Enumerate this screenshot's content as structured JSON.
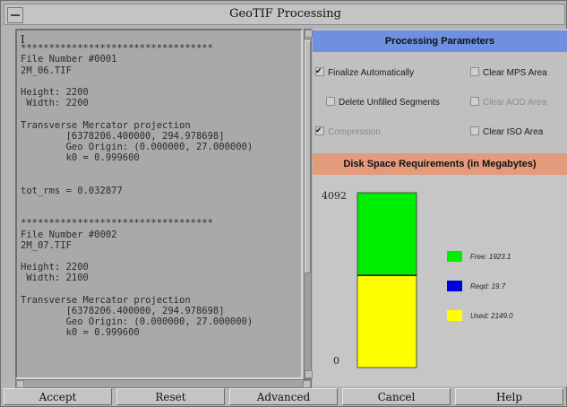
{
  "window": {
    "title": "GeoTIF Processing"
  },
  "log": {
    "caret": "I",
    "text": "\n**********************************\nFile Number #0001\n2M_06.TIF\n\nHeight: 2200\n Width: 2200\n\nTransverse Mercator projection\n        [6378206.400000, 294.978698]\n        Geo Origin: (0.000000, 27.000000)\n        k0 = 0.999600\n\n\ntot_rms = 0.032877\n\n\n**********************************\nFile Number #0002\n2M_07.TIF\n\nHeight: 2200\n Width: 2100\n\nTransverse Mercator projection\n        [6378206.400000, 294.978698]\n        Geo Origin: (0.000000, 27.000000)\n        k0 = 0.999600"
  },
  "params": {
    "header": "Processing Parameters",
    "finalize": {
      "label": "Finalize Automatically",
      "checked": true,
      "enabled": true
    },
    "clear_mps": {
      "label": "Clear MPS Area",
      "checked": false,
      "enabled": true
    },
    "delete_unfilled": {
      "label": "Delete Unfilled Segments",
      "checked": false,
      "enabled": true
    },
    "clear_aod": {
      "label": "Clear AOD Area",
      "checked": false,
      "enabled": false
    },
    "compression": {
      "label": "Compression",
      "checked": true,
      "enabled": false
    },
    "clear_iso": {
      "label": "Clear ISO Area",
      "checked": false,
      "enabled": true
    }
  },
  "disk": {
    "header": "Disk Space Requirements (in Megabytes)",
    "colors": {
      "free": "#00ee00",
      "reqd": "#0000dd",
      "used": "#ffff00"
    }
  },
  "chart_data": {
    "type": "bar",
    "stacked": true,
    "ylim": [
      0,
      4092
    ],
    "tick_labels": [
      "4092",
      "0"
    ],
    "series": [
      {
        "name": "Used:",
        "value": 2149.0,
        "label": "2149.0",
        "color": "#ffff00"
      },
      {
        "name": "Reqd:",
        "value": 19.7,
        "label": "19.7",
        "color": "#0000dd"
      },
      {
        "name": "Free:",
        "value": 1923.1,
        "label": "1923.1",
        "color": "#00ee00"
      }
    ],
    "legend": [
      {
        "name": "Free:",
        "label": "1923.1",
        "color": "#00ee00"
      },
      {
        "name": "Reqd:",
        "label": "19.7",
        "color": "#0000dd"
      },
      {
        "name": "Used:",
        "label": "2149.0",
        "color": "#ffff00"
      }
    ]
  },
  "buttons": {
    "accept": "Accept",
    "reset": "Reset",
    "advanced": "Advanced",
    "cancel": "Cancel",
    "help": "Help"
  }
}
